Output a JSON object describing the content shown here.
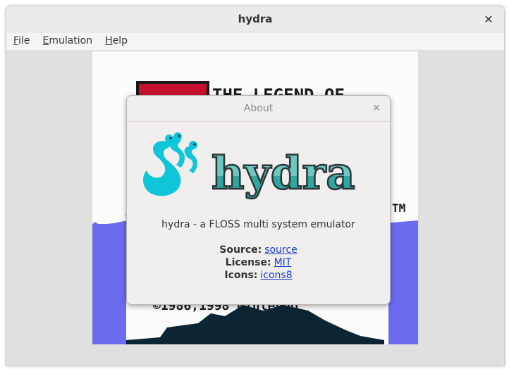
{
  "window": {
    "title": "hydra",
    "close_glyph": "✕"
  },
  "menubar": {
    "items": [
      {
        "accel": "F",
        "rest": "ile"
      },
      {
        "accel": "E",
        "rest": "mulation"
      },
      {
        "accel": "H",
        "rest": "elp"
      }
    ]
  },
  "game": {
    "title_text": "THE LEGEND OF",
    "tm_text": "TM",
    "copyright_text": "©1986,1998 Nintendo"
  },
  "about": {
    "title": "About",
    "close_glyph": "✕",
    "logo_text": "hydra",
    "description": "hydra - a FLOSS multi system emulator",
    "source_label": "Source:",
    "source_link": "source",
    "license_label": "License:",
    "license_link": "MIT",
    "icons_label": "Icons:",
    "icons_link": "icons8"
  },
  "colors": {
    "link": "#1a3ecc",
    "logo_teal": "#11c5d9",
    "logo_text_fill": "#6cc7c3",
    "game_blue": "#6b6bf0",
    "game_red": "#c8102e"
  }
}
